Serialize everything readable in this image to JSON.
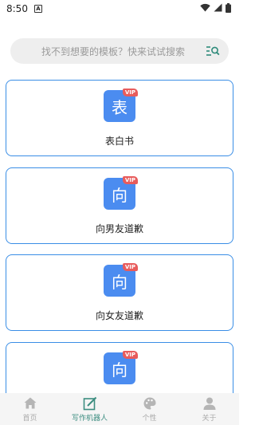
{
  "status_bar": {
    "time": "8:50",
    "app_icon_glyph": "A",
    "icons": [
      "wifi-icon",
      "signal-icon",
      "battery-icon"
    ]
  },
  "search": {
    "placeholder": "找不到想要的模板？快来试试搜索",
    "icon": "search-list-icon",
    "icon_color": "#2e8b7a"
  },
  "templates": [
    {
      "glyph": "表",
      "badge": "VIP",
      "title": "表白书"
    },
    {
      "glyph": "向",
      "badge": "VIP",
      "title": "向男友道歉"
    },
    {
      "glyph": "向",
      "badge": "VIP",
      "title": "向女友道歉"
    },
    {
      "glyph": "向",
      "badge": "VIP",
      "title": ""
    }
  ],
  "bottom_nav": {
    "items": [
      {
        "label": "首页",
        "icon": "home-icon",
        "active": false
      },
      {
        "label": "写作机器人",
        "icon": "edit-icon",
        "active": true
      },
      {
        "label": "个性",
        "icon": "palette-icon",
        "active": false
      },
      {
        "label": "关于",
        "icon": "person-icon",
        "active": false
      }
    ]
  },
  "colors": {
    "card_border": "#3a8ee6",
    "tile": "#4b8cf0",
    "vip_badge": "#e85c5c",
    "nav_active": "#3c8d80",
    "nav_inactive": "#aaaaaa"
  }
}
